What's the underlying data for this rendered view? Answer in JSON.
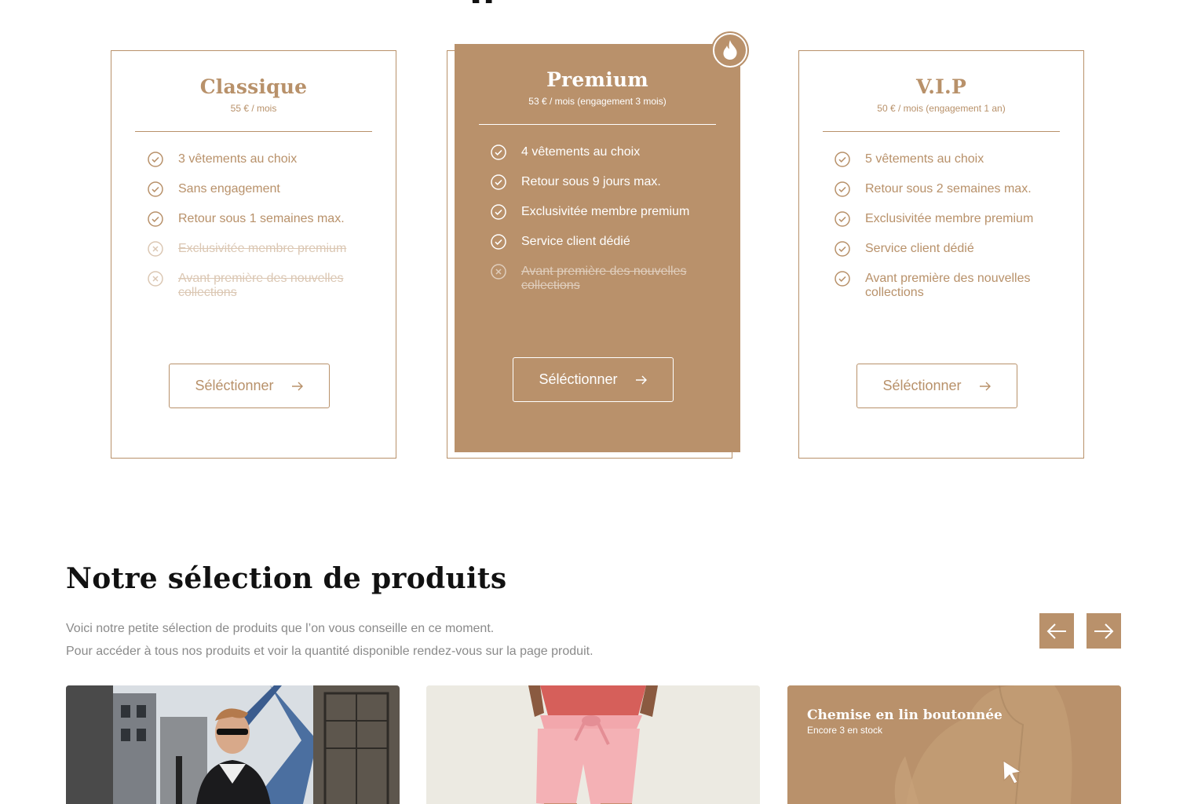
{
  "plans": [
    {
      "title": "Classique",
      "price": "55 € / mois",
      "features": [
        {
          "text": "3 vêtements au choix",
          "included": true
        },
        {
          "text": "Sans engagement",
          "included": true
        },
        {
          "text": "Retour sous 1 semaines max.",
          "included": true
        },
        {
          "text": "Exclusivitée membre premium",
          "included": false
        },
        {
          "text": "Avant première des nouvelles collections",
          "included": false
        }
      ],
      "button": "Séléctionner"
    },
    {
      "title": "Premium",
      "price": "53 € / mois (engagement 3 mois)",
      "features": [
        {
          "text": "4 vêtements au choix",
          "included": true
        },
        {
          "text": "Retour sous 9 jours max.",
          "included": true
        },
        {
          "text": "Exclusivitée membre premium",
          "included": true
        },
        {
          "text": "Service client dédié",
          "included": true
        },
        {
          "text": "Avant première des nouvelles collections",
          "included": false
        }
      ],
      "button": "Séléctionner",
      "badge_icon": "flame-icon"
    },
    {
      "title": "V.I.P",
      "price": "50 € / mois (engagement 1 an)",
      "features": [
        {
          "text": "5 vêtements au choix",
          "included": true
        },
        {
          "text": "Retour sous 2 semaines max.",
          "included": true
        },
        {
          "text": "Exclusivitée membre premium",
          "included": true
        },
        {
          "text": "Service client dédié",
          "included": true
        },
        {
          "text": "Avant première des nouvelles collections",
          "included": true
        }
      ],
      "button": "Séléctionner"
    }
  ],
  "products_section": {
    "title": "Notre sélection de produits",
    "description_line1": "Voici notre petite sélection de produits que l’on vous conseille en ce moment.",
    "description_line2": "Pour accéder à tous nos produits et voir la quantité disponible rendez-vous sur la page produit.",
    "prev_icon": "arrow-left-icon",
    "next_icon": "arrow-right-icon"
  },
  "products": [
    {
      "image": "man-sunglasses-city-photo"
    },
    {
      "image": "pink-shorts-photo"
    },
    {
      "image": "linen-shirt-photo",
      "name": "Chemise en lin boutonnée",
      "stock": "Encore 3 en stock"
    }
  ],
  "colors": {
    "accent": "#b9916b",
    "text_dark": "#111111",
    "text_muted": "#8a8a8a"
  }
}
